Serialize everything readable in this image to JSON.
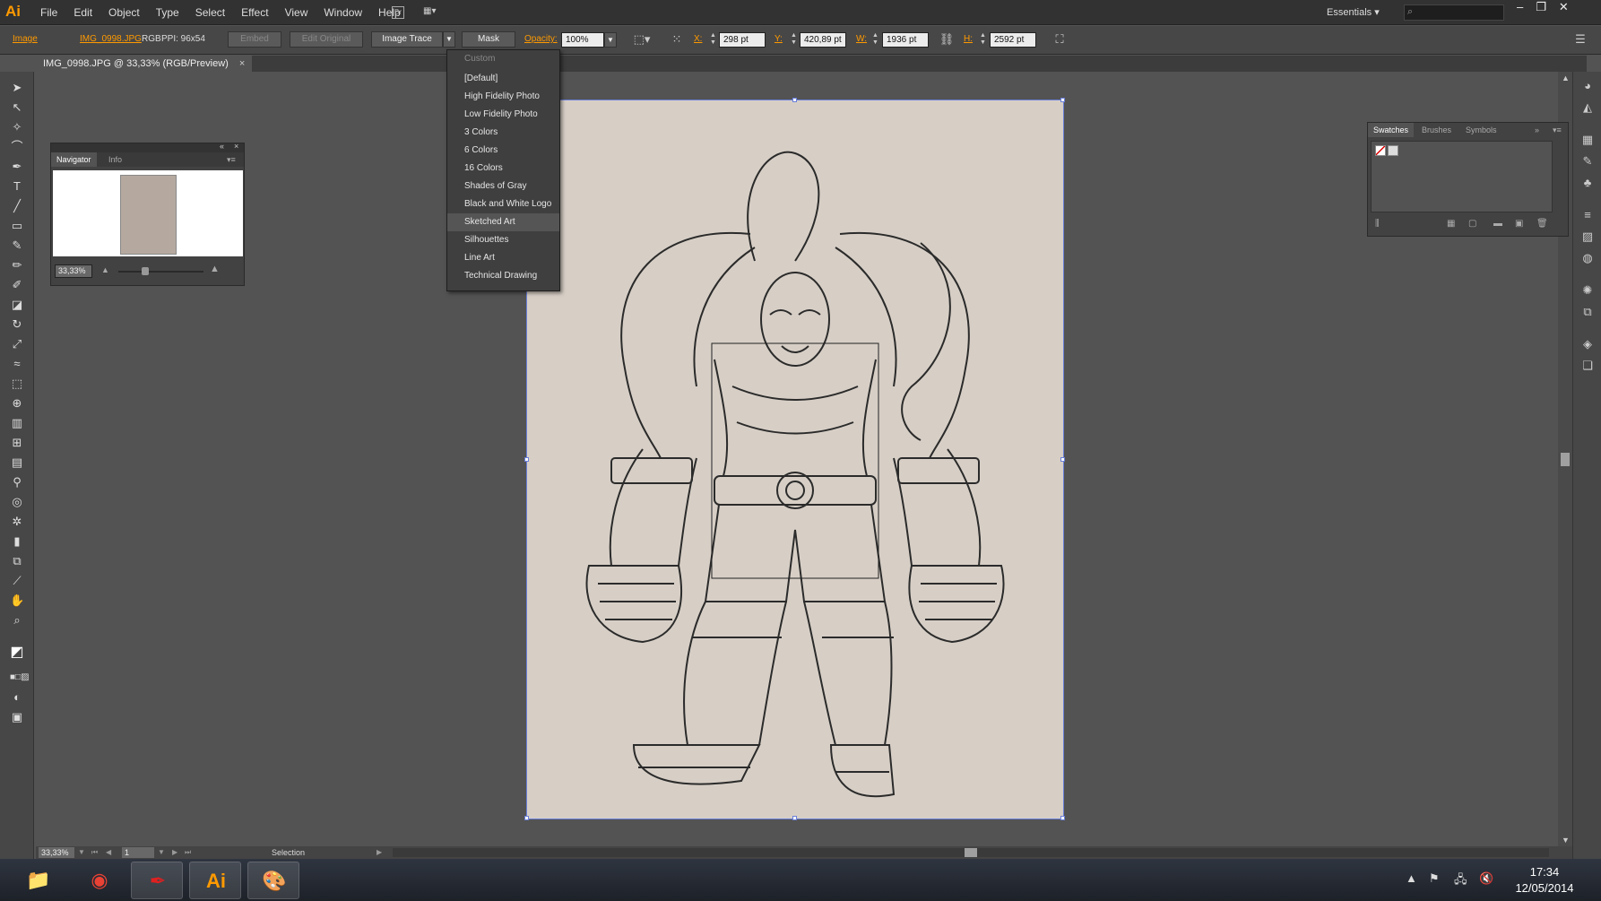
{
  "app": {
    "logo": "Ai",
    "workspace": "Essentials ▾"
  },
  "menubar": {
    "items": [
      "File",
      "Edit",
      "Object",
      "Type",
      "Select",
      "Effect",
      "View",
      "Window",
      "Help"
    ]
  },
  "controlbar": {
    "object_type": "Image",
    "file_name": "IMG_0998.JPG",
    "color_mode": "RGB",
    "ppi": "PPI: 96x54",
    "embed_label": "Embed",
    "edit_original_label": "Edit Original",
    "image_trace_label": "Image Trace",
    "mask_label": "Mask",
    "opacity_label": "Opacity:",
    "opacity_value": "100%",
    "x_label": "X:",
    "x_value": "298 pt",
    "y_label": "Y:",
    "y_value": "420,89 pt",
    "w_label": "W:",
    "w_value": "1936 pt",
    "h_label": "H:",
    "h_value": "2592 pt"
  },
  "document": {
    "tab_title": "IMG_0998.JPG @ 33,33% (RGB/Preview)",
    "close": "×"
  },
  "trace_menu": {
    "items": [
      {
        "label": "Custom",
        "dim": true
      },
      {
        "label": "[Default]"
      },
      {
        "label": "High Fidelity Photo"
      },
      {
        "label": "Low Fidelity Photo"
      },
      {
        "label": "3 Colors"
      },
      {
        "label": "6 Colors"
      },
      {
        "label": "16 Colors"
      },
      {
        "label": "Shades of Gray"
      },
      {
        "label": "Black and White Logo"
      },
      {
        "label": "Sketched Art",
        "highlighted": true
      },
      {
        "label": "Silhouettes"
      },
      {
        "label": "Line Art"
      },
      {
        "label": "Technical Drawing"
      }
    ]
  },
  "navigator_panel": {
    "tabs": [
      "Navigator",
      "Info"
    ],
    "zoom": "33,33%"
  },
  "swatches_panel": {
    "tabs": [
      "Swatches",
      "Brushes",
      "Symbols"
    ]
  },
  "statusbar": {
    "zoom": "33,33%",
    "page": "1",
    "current_tool": "Selection"
  },
  "taskbar": {
    "apps": [
      {
        "name": "file-explorer",
        "label": "📁"
      },
      {
        "name": "chrome",
        "label": "◉"
      },
      {
        "name": "acrobat",
        "label": "✒"
      },
      {
        "name": "illustrator",
        "label": "Ai"
      },
      {
        "name": "paint",
        "label": "🎨"
      }
    ],
    "time": "17:34",
    "date": "12/05/2014"
  },
  "colors": {
    "accent": "#ff9a00",
    "selection": "#6a7fd8",
    "paper": "#d7cfc6"
  }
}
